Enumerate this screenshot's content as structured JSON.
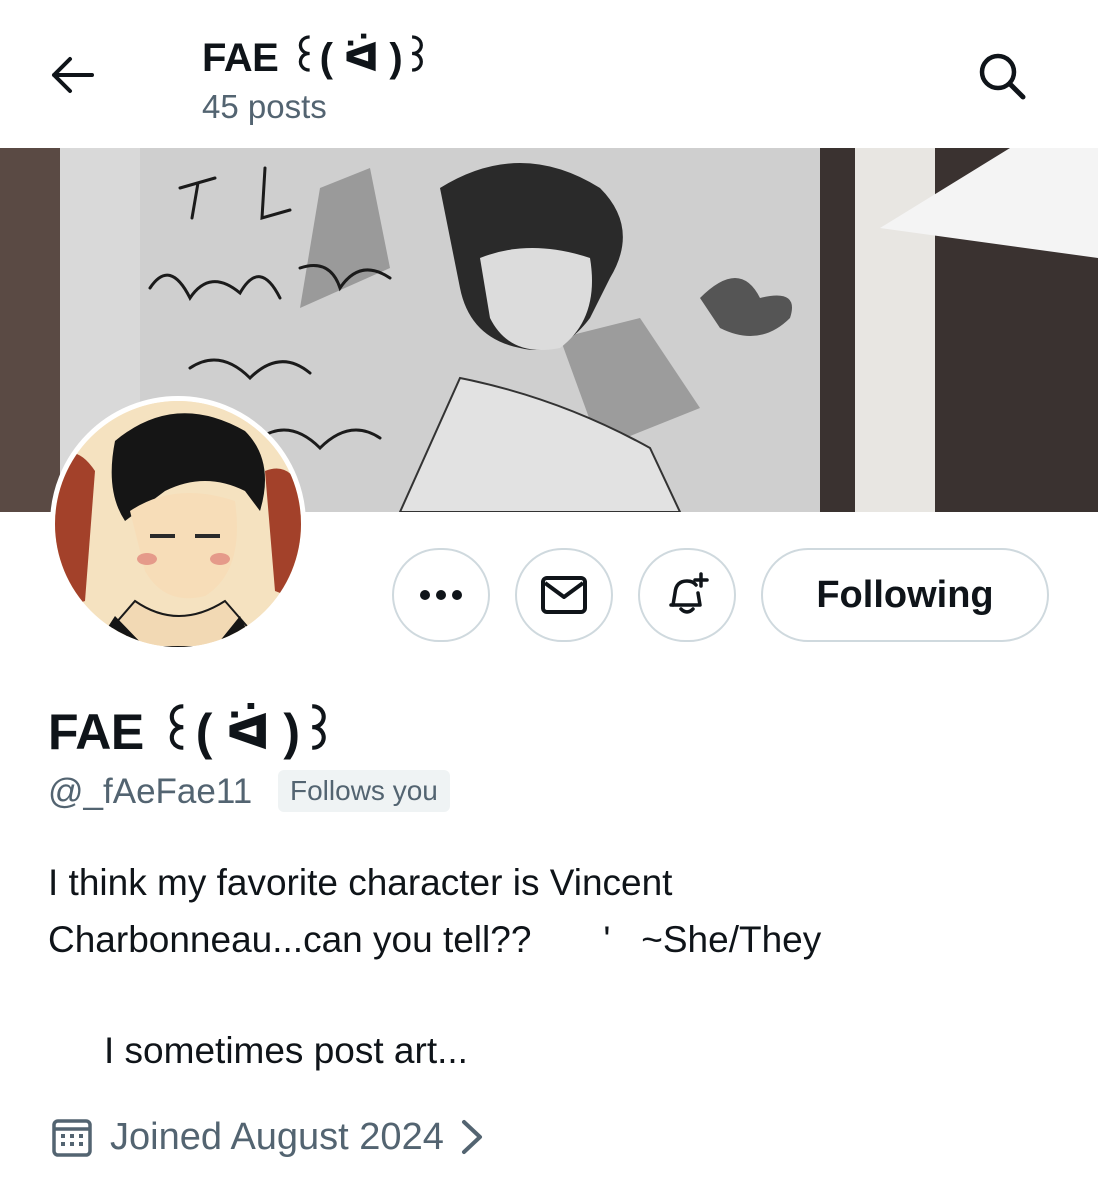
{
  "header": {
    "title": "FAE ꒰( ᐛ )꒱",
    "subtitle": "45 posts",
    "back_icon": "arrow-left-icon",
    "search_icon": "search-icon"
  },
  "banner": {
    "handwritten_lines": [
      "To Lily",
      "hank you",
      "for your",
      "...age"
    ]
  },
  "actions": {
    "more_icon": "more-horizontal-icon",
    "message_icon": "envelope-icon",
    "notify_icon": "bell-plus-icon",
    "follow_label": "Following"
  },
  "profile": {
    "name": "FAE ꒰( ᐛ )꒱",
    "handle": "@_fAeFae11",
    "follows_you": "Follows you",
    "bio_line1": "I think my favorite character is Vincent",
    "bio_line2": "Charbonneau...can you tell??       '   ~She/They",
    "bio_line3": "I sometimes post art...",
    "joined": "Joined August 2024"
  },
  "colors": {
    "text_primary": "#0f1419",
    "text_secondary": "#536471",
    "border": "#cfd9de",
    "badge_bg": "#eff3f4"
  }
}
